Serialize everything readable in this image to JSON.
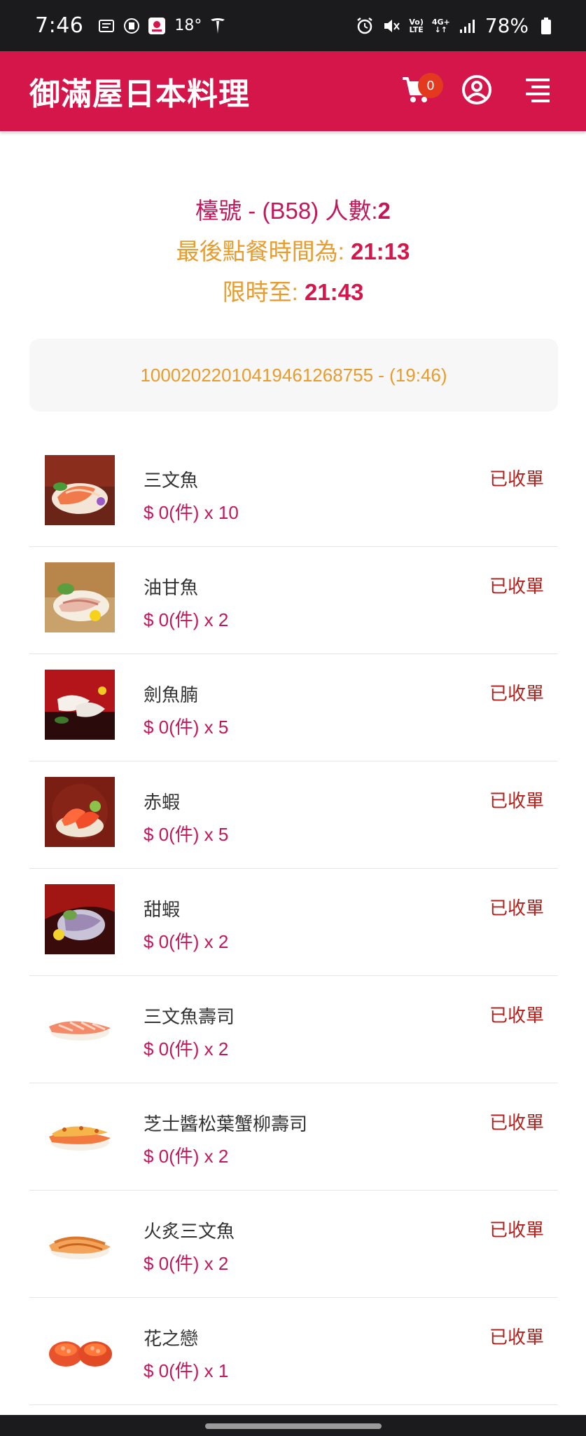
{
  "status_bar": {
    "time": "7:46",
    "temperature": "18°",
    "battery": "78%",
    "network_top": "Vo)",
    "network_bottom": "LTE",
    "data_type": "4G+"
  },
  "header": {
    "title": "御滿屋日本料理",
    "cart_count": "0",
    "accent_color": "#d4164b"
  },
  "table_info": {
    "line1_prefix": "檯號 - (B58) 人數:",
    "line1_count": "2",
    "line2_prefix": "最後點餐時間為: ",
    "line2_time": "21:13",
    "line3_prefix": "限時至: ",
    "line3_time": "21:43"
  },
  "order": {
    "label": "10002022010419461268755 - (19:46)"
  },
  "items": [
    {
      "name": "三文魚",
      "price": "$ 0(件) x 10",
      "status": "已收單",
      "icon": "salmon-sashimi-image"
    },
    {
      "name": "油甘魚",
      "price": "$ 0(件) x 2",
      "status": "已收單",
      "icon": "yellowtail-sashimi-image"
    },
    {
      "name": "劍魚腩",
      "price": "$ 0(件) x 5",
      "status": "已收單",
      "icon": "swordfish-belly-image"
    },
    {
      "name": "赤蝦",
      "price": "$ 0(件) x 5",
      "status": "已收單",
      "icon": "red-shrimp-image"
    },
    {
      "name": "甜蝦",
      "price": "$ 0(件) x 2",
      "status": "已收單",
      "icon": "sweet-shrimp-image"
    },
    {
      "name": "三文魚壽司",
      "price": "$ 0(件) x 2",
      "status": "已收單",
      "icon": "salmon-sushi-image"
    },
    {
      "name": "芝士醬松葉蟹柳壽司",
      "price": "$ 0(件) x 2",
      "status": "已收單",
      "icon": "cheese-crab-sushi-image"
    },
    {
      "name": "火炙三文魚",
      "price": "$ 0(件) x 2",
      "status": "已收單",
      "icon": "seared-salmon-image"
    },
    {
      "name": "花之戀",
      "price": "$ 0(件) x 1",
      "status": "已收單",
      "icon": "salmon-roe-roll-image"
    }
  ]
}
